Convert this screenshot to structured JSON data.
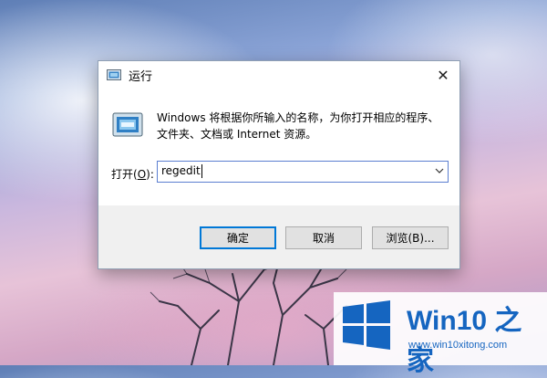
{
  "dialog": {
    "title": "运行",
    "close_glyph": "✕",
    "description": "Windows 将根据你所输入的名称，为你打开相应的程序、文件夹、文档或 Internet 资源。",
    "open_label_pre": "打开(",
    "open_label_key": "O",
    "open_label_post": "):",
    "command_value": "regedit",
    "buttons": {
      "ok": "确定",
      "cancel": "取消",
      "browse": "浏览(B)..."
    },
    "icons": [
      "run-icon",
      "close-icon",
      "chevron-down-icon"
    ]
  },
  "watermark": {
    "logo_text": "Win10 之家",
    "url": "www.win10xitong.com",
    "accent": "#1565c0"
  },
  "colors": {
    "dialog_border": "#8f9fb4",
    "focus_border": "#5b7fd1",
    "default_button_border": "#0078d7",
    "footer_bg": "#f0f0f0"
  }
}
